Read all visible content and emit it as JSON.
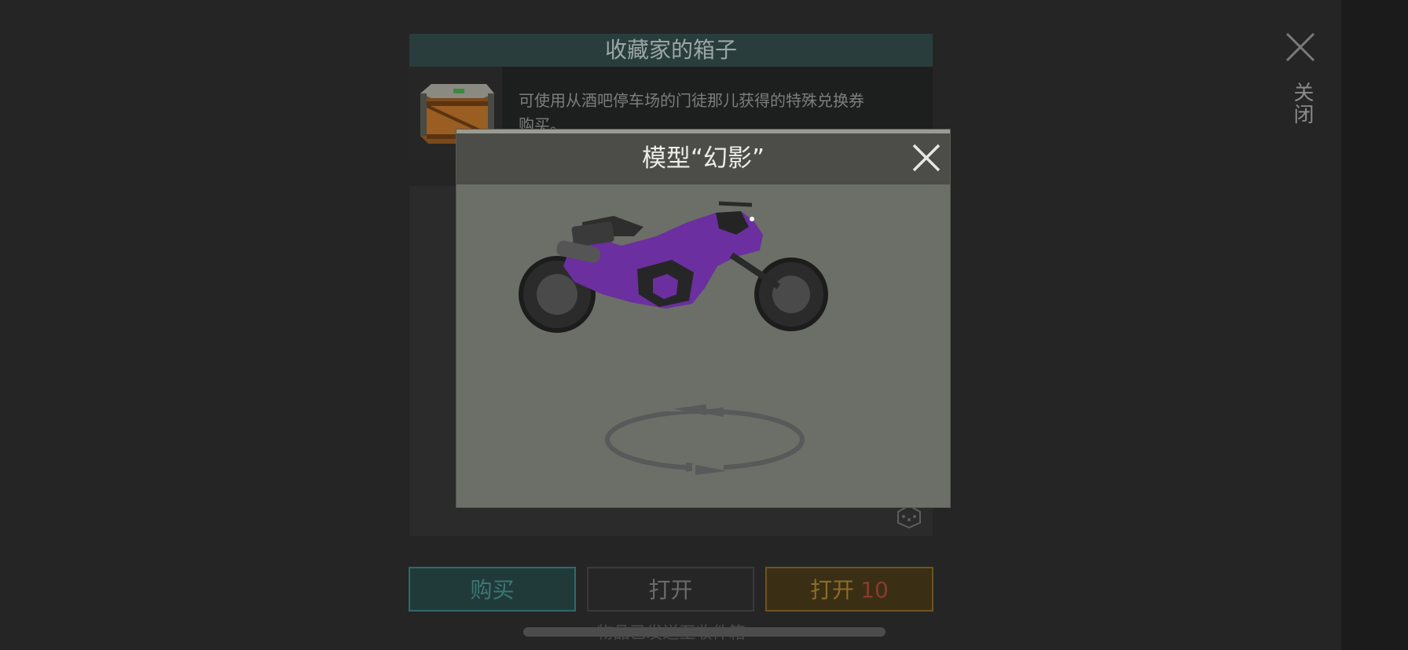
{
  "screen": {
    "close_label": "关闭"
  },
  "chest": {
    "title": "收藏家的箱子",
    "description": "可使用从酒吧停车场的门徒那儿获得的特殊兑换券购买。"
  },
  "buttons": {
    "buy": "购买",
    "open": "打开",
    "open10_label": "打开",
    "open10_count": "10"
  },
  "footer_text": "物品已发送至收件箱",
  "model_preview": {
    "title": "模型“幻影”"
  },
  "colors": {
    "accent_teal": "#2f6a68",
    "accent_orange": "#6d5520",
    "bike_purple": "#6b2fa0"
  },
  "icons": [
    "close-icon",
    "chest-icon",
    "motorcycle-model",
    "rotate-icon",
    "dice-icon"
  ]
}
